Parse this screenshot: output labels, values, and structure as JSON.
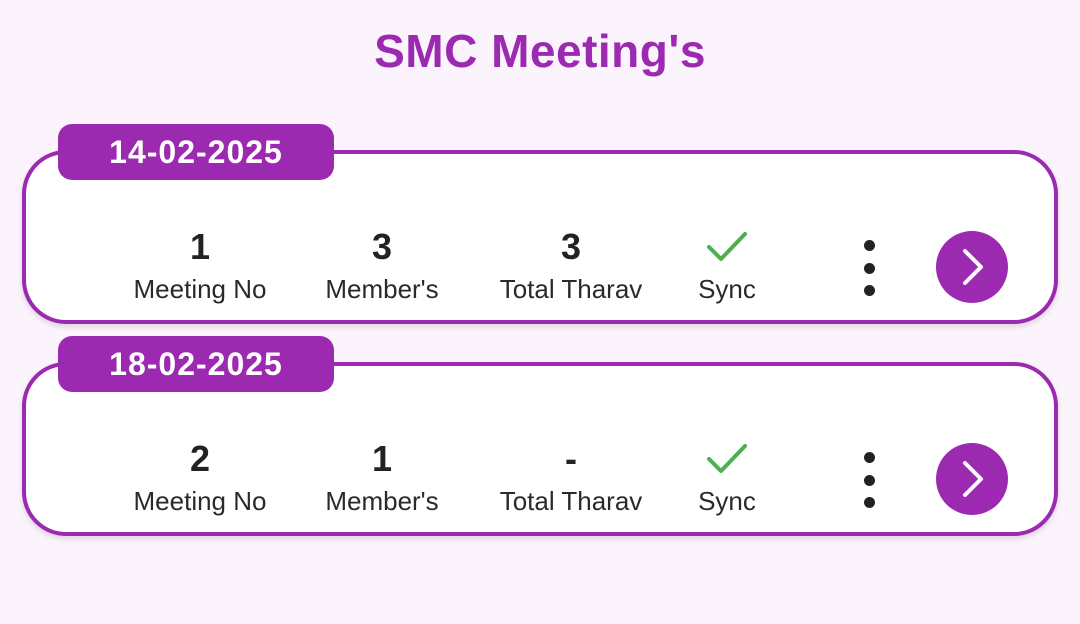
{
  "page": {
    "title": "SMC Meeting's"
  },
  "colors": {
    "accent": "#9B2AB0",
    "background": "#FCF4FD",
    "sync_check": "#4CAF50"
  },
  "labels": {
    "meeting_no": "Meeting No",
    "members": "Member's",
    "total_tharav": "Total Tharav",
    "sync": "Sync"
  },
  "meetings": [
    {
      "date": "14-02-2025",
      "meeting_no": "1",
      "members": "3",
      "total_tharav": "3",
      "sync_icon": "check-icon",
      "menu_icon": "more-vertical-icon",
      "open_icon": "chevron-right-icon"
    },
    {
      "date": "18-02-2025",
      "meeting_no": "2",
      "members": "1",
      "total_tharav": "-",
      "sync_icon": "check-icon",
      "menu_icon": "more-vertical-icon",
      "open_icon": "chevron-right-icon"
    }
  ]
}
